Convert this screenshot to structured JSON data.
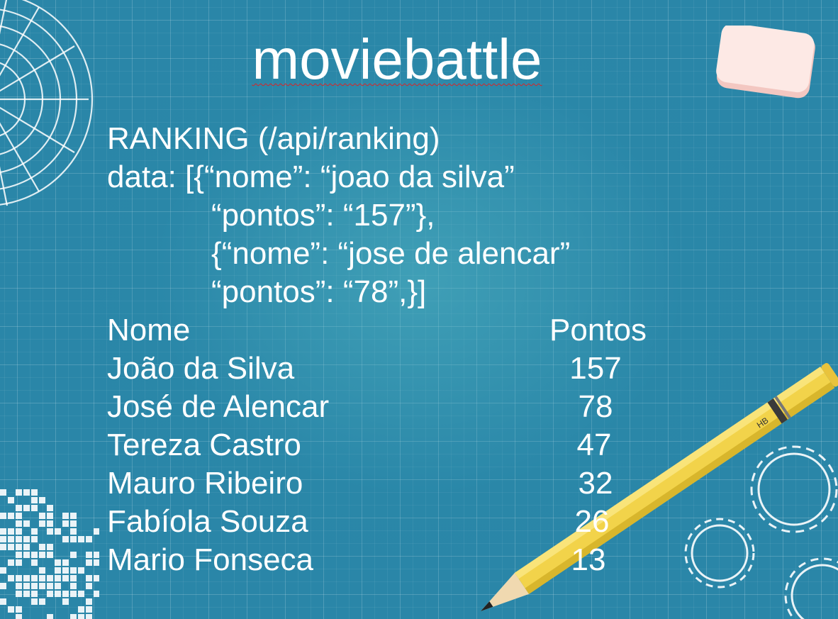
{
  "title": "moviebattle",
  "api": {
    "line1": "RANKING (/api/ranking)",
    "line2": "data: [{“nome”: “joao da silva”",
    "line3": "“pontos”: “157”},",
    "line4": "{“nome”: “jose de alencar”",
    "line5": "“pontos”: “78”,}]"
  },
  "table": {
    "header_name": "Nome",
    "header_points": "Pontos",
    "rows": [
      {
        "nome": "João da Silva",
        "pontos": "157"
      },
      {
        "nome": "José de Alencar",
        "pontos": "78"
      },
      {
        "nome": "Tereza Castro",
        "pontos": "47"
      },
      {
        "nome": "Mauro Ribeiro",
        "pontos": "32"
      },
      {
        "nome": "Fabíola Souza",
        "pontos": "26"
      },
      {
        "nome": "Mario Fonseca",
        "pontos": "13"
      }
    ]
  },
  "decor": {
    "pencil_label": "HB",
    "pencil_color": "#f2d34a",
    "eraser_color": "#fbe3df"
  }
}
